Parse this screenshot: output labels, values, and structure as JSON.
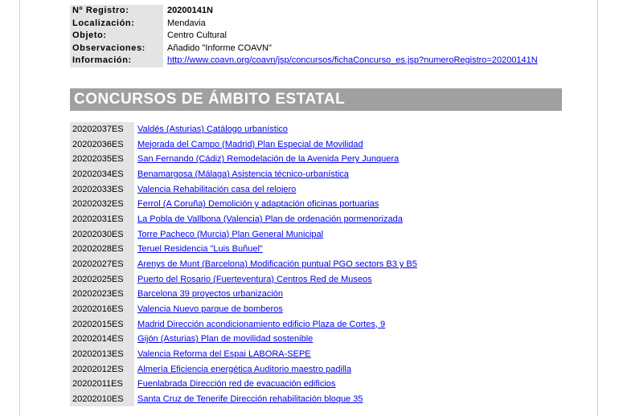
{
  "registro": {
    "rows": [
      {
        "label": "Nº Registro:",
        "value": "20200141N"
      },
      {
        "label": "Localización:",
        "value": "Mendavia"
      },
      {
        "label": "Objeto:",
        "value": "Centro Cultural"
      },
      {
        "label": "Observaciones:",
        "value": "Añadido \"Informe COAVN\""
      },
      {
        "label": "Información:",
        "value": "http://www.coavn.org/coavn/jsp/concursos/fichaConcurso_es.jsp?numeroRegistro=20200141N"
      }
    ]
  },
  "section": {
    "title": "CONCURSOS DE ÁMBITO ESTATAL"
  },
  "contests": [
    {
      "code": "20202037ES",
      "title": "Valdés (Asturias) Catálogo urbanístico "
    },
    {
      "code": "20202036ES",
      "title": "Mejorada del Campo (Madrid) Plan Especial de Movilidad "
    },
    {
      "code": "20202035ES",
      "title": "San Fernando (Cádiz) Remodelación de la Avenida Pery Junquera"
    },
    {
      "code": "20202034ES",
      "title": "Benamargosa (Málaga) Asistencia técnico-urbanística"
    },
    {
      "code": "20202033ES",
      "title": "Valencia Rehabilitación casa del relojero"
    },
    {
      "code": "20202032ES",
      "title": "Ferrol (A Coruña) Demolición y adaptación oficinas portuarias"
    },
    {
      "code": "20202031ES",
      "title": "La Pobla de Vallbona (Valencia) Plan de ordenación pormenorizada"
    },
    {
      "code": "20202030ES",
      "title": "Torre Pacheco (Murcia) Plan General Municipal"
    },
    {
      "code": "20202028ES",
      "title": "Teruel Residencia \"Luis Buñuel\""
    },
    {
      "code": "20202027ES",
      "title": "Arenys de Munt (Barcelona) Modificación puntual PGO sectors B3 y B5"
    },
    {
      "code": "20202025ES",
      "title": "Puerto del Rosario (Fuerteventura) Centros Red de Museos"
    },
    {
      "code": "20202023ES",
      "title": "Barcelona 39 proyectos urbanización"
    },
    {
      "code": "20202016ES",
      "title": "Valencia Nuevo parque de bomberos"
    },
    {
      "code": "20202015ES",
      "title": "Madrid Dirección acondicionamiento edificio Plaza de Cortes, 9"
    },
    {
      "code": "20202014ES",
      "title": "Gijón (Asturias) Plan de movilidad sostenible"
    },
    {
      "code": "20202013ES",
      "title": "Valencia Reforma del Espai LABORA-SEPE "
    },
    {
      "code": "20202012ES",
      "title": "Almería Eficiencia energética Auditorio maestro padilla"
    },
    {
      "code": "20202011ES",
      "title": "Fuenlabrada Dirección red de evacuación edificios "
    },
    {
      "code": "20202010ES",
      "title": "Santa Cruz de Tenerife Dirección rehabilitación bloque 35"
    }
  ]
}
